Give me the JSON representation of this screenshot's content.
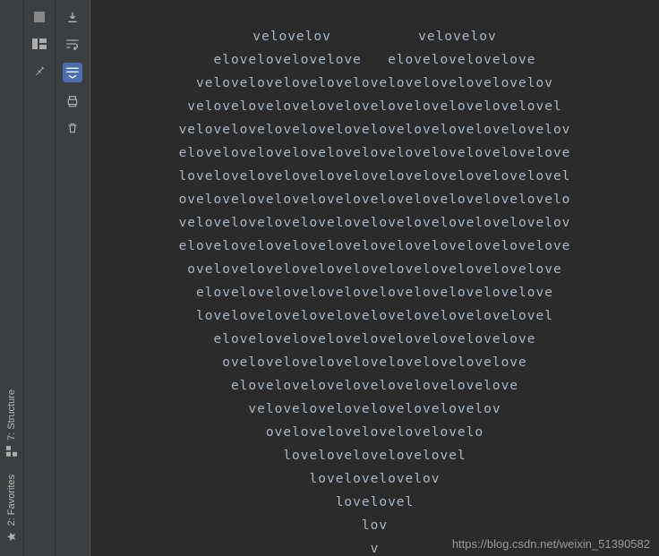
{
  "rail": {
    "structure": "7: Structure",
    "favorites": "2: Favorites"
  },
  "lines": [
    "velovelov          velovelov",
    "elovelovelovelove   elovelovelovelove",
    "velovelovelovelovelovelovelovelovelovelov",
    "velovelovelovelovelovelovelovelovelovelovel",
    "velovelovelovelovelovelovelovelovelovelovelov",
    "elovelovelovelovelovelovelovelovelovelovelove",
    "lovelovelovelovelovelovelovelovelovelovelovel",
    "ovelovelovelovelovelovelovelovelovelovelovelo",
    "velovelovelovelovelovelovelovelovelovelovelov",
    "elovelovelovelovelovelovelovelovelovelovelove",
    "ovelovelovelovelovelovelovelovelovelovelove",
    "elovelovelovelovelovelovelovelovelovelove",
    "lovelovelovelovelovelovelovelovelovelovel",
    "elovelovelovelovelovelovelovelovelove",
    "ovelovelovelovelovelovelovelovelove",
    "elovelovelovelovelovelovelovelove",
    "velovelovelovelovelovelovelov",
    "ovelovelovelovelovelovelo",
    "lovelovelovelovelovel",
    "lovelovelovelov",
    "lovelovel",
    "lov",
    "v"
  ],
  "watermark": "https://blog.csdn.net/weixin_51390582"
}
